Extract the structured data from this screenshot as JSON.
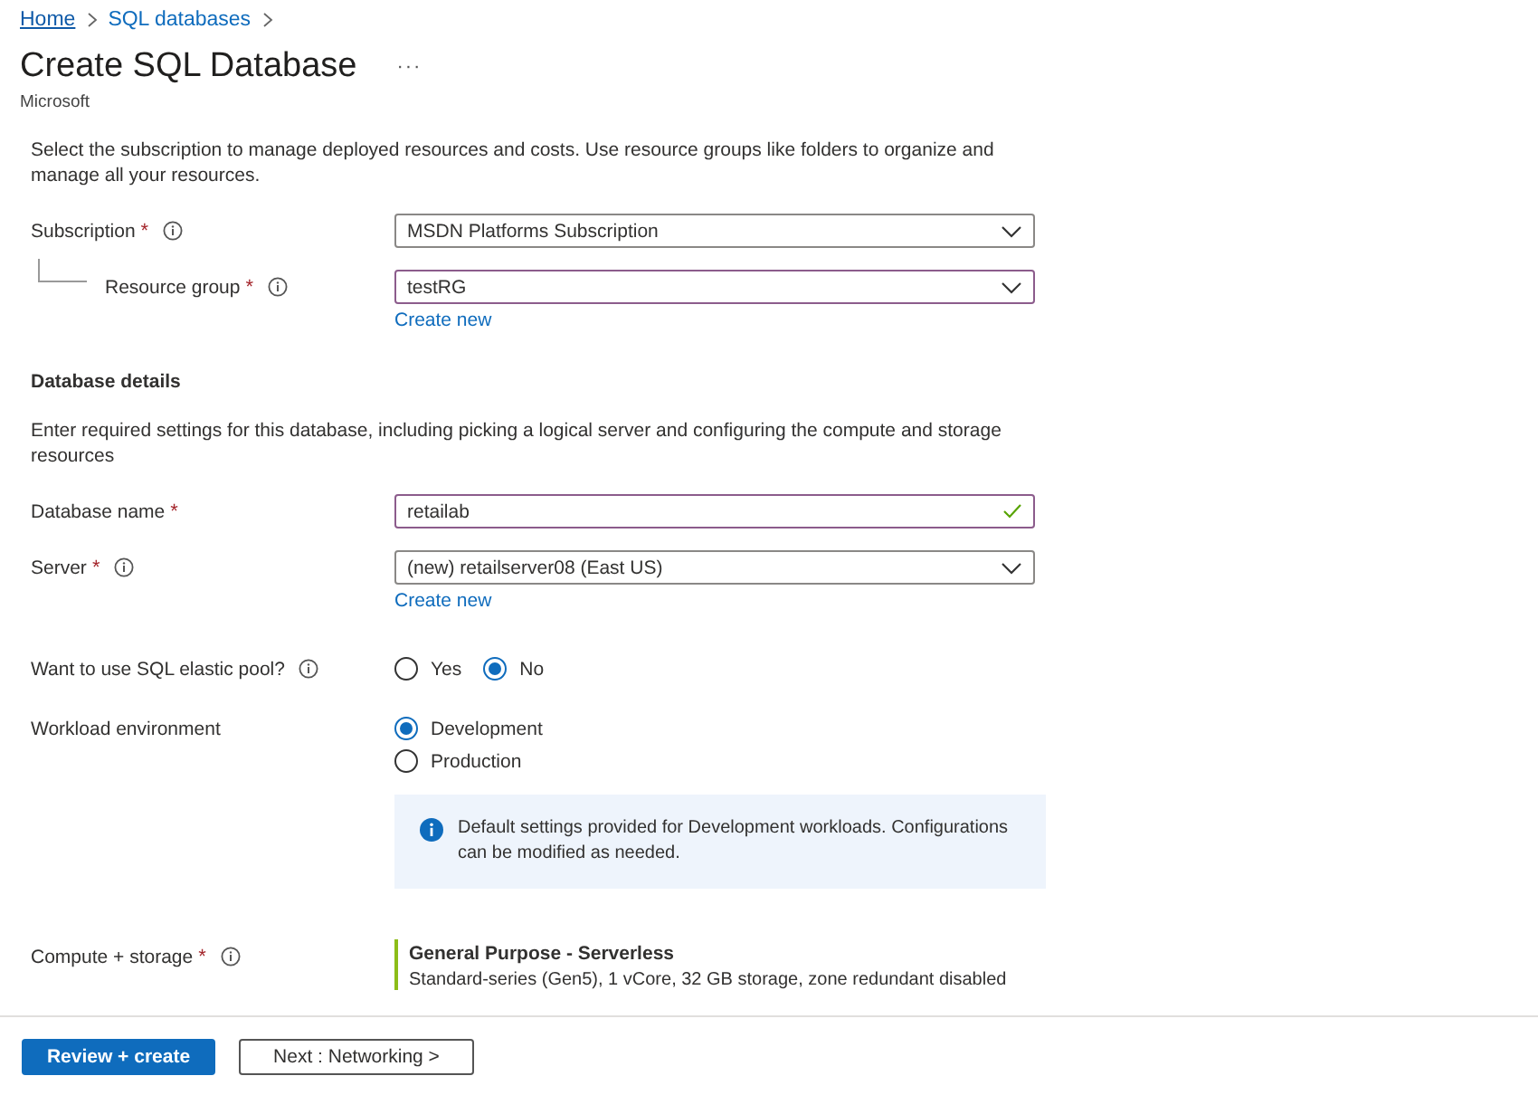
{
  "breadcrumb": [
    {
      "label": "Home",
      "kind": "link"
    },
    {
      "label": "SQL databases",
      "kind": "current"
    }
  ],
  "title": "Create SQL Database",
  "more_button": "···",
  "publisher": "Microsoft",
  "rows": [
    {
      "kind": "paragraph",
      "text": "Select the subscription to manage deployed resources and costs. Use resource groups like folders to organize and manage all your resources."
    },
    {
      "kind": "select",
      "label": "Subscription",
      "required_mark": "*",
      "info": true,
      "highlighted": false,
      "value": "MSDN Platforms Subscription",
      "children": [
        {
          "kind": "select",
          "label": "Resource group",
          "required_mark": "*",
          "info": true,
          "highlighted": true,
          "value": "testRG",
          "link": "Create new"
        }
      ]
    },
    {
      "kind": "heading",
      "text": "Database details"
    },
    {
      "kind": "paragraph",
      "text": "Enter required settings for this database, including picking a logical server and configuring the compute and storage resources"
    },
    {
      "kind": "text",
      "label": "Database name",
      "required_mark": "*",
      "highlighted": true,
      "valid": true,
      "value": "retailab"
    },
    {
      "kind": "select",
      "label": "Server",
      "required_mark": "*",
      "info": true,
      "highlighted": false,
      "value": "(new) retailserver08 (East US)",
      "link": "Create new"
    },
    {
      "kind": "radio_row",
      "label": "Want to use SQL elastic pool?",
      "info": true,
      "options": [
        {
          "label": "Yes",
          "selected": false
        },
        {
          "label": "No",
          "selected": true
        }
      ]
    },
    {
      "kind": "radio_column",
      "label": "Workload environment",
      "options": [
        {
          "label": "Development",
          "selected": true
        },
        {
          "label": "Production",
          "selected": false
        }
      ]
    },
    {
      "kind": "infobox",
      "text": "Default settings provided for Development workloads. Configurations can be modified as needed."
    },
    {
      "kind": "compute",
      "label": "Compute + storage",
      "required_mark": "*",
      "info": true,
      "title": "General Purpose - Serverless",
      "detail": "Standard-series (Gen5), 1 vCore, 32 GB storage, zone redundant disabled"
    }
  ],
  "footer_buttons": [
    {
      "label": "Review + create",
      "kind": "primary"
    },
    {
      "label": "Next : Networking >",
      "kind": "secondary"
    }
  ]
}
